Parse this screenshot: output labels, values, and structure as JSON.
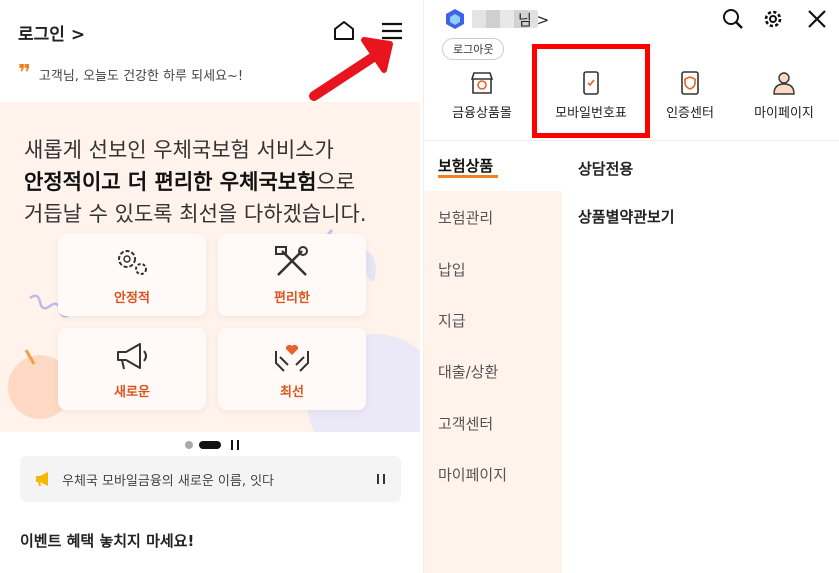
{
  "left": {
    "login_label": "로그인 >",
    "greeting": "고객님, 오늘도 건강한 하루 되세요~!",
    "hero": {
      "line1": "새롭게 선보인 우체국보험 서비스가",
      "line2_bold": "안정적이고 더 편리한 우체국보험",
      "line2_rest": "으로",
      "line3": "거듭날 수 있도록 최선을 다하겠습니다."
    },
    "features": [
      "안정적",
      "편리한",
      "새로운",
      "최선"
    ],
    "notice": "우체국 모바일금융의 새로운 이름, 잇다",
    "event_title": "이벤트 혜택 놓치지 마세요!"
  },
  "right": {
    "user_suffix": "님 >",
    "logout_label": "로그아웃",
    "quick_menu": [
      {
        "label": "금융상품몰",
        "icon": "store-icon"
      },
      {
        "label": "모바일번호표",
        "icon": "mobile-ticket-icon"
      },
      {
        "label": "인증센터",
        "icon": "certificate-icon"
      },
      {
        "label": "마이페이지",
        "icon": "person-icon"
      }
    ],
    "categories": [
      "보험상품",
      "보험관리",
      "납입",
      "지급",
      "대출/상환",
      "고객센터",
      "마이페이지"
    ],
    "sub_items": [
      "상담전용",
      "상품별약관보기"
    ]
  },
  "colors": {
    "accent": "#f08020",
    "feature_text": "#d9541e",
    "hero_bg": "#fff3ec",
    "highlight": "#ff0000"
  }
}
